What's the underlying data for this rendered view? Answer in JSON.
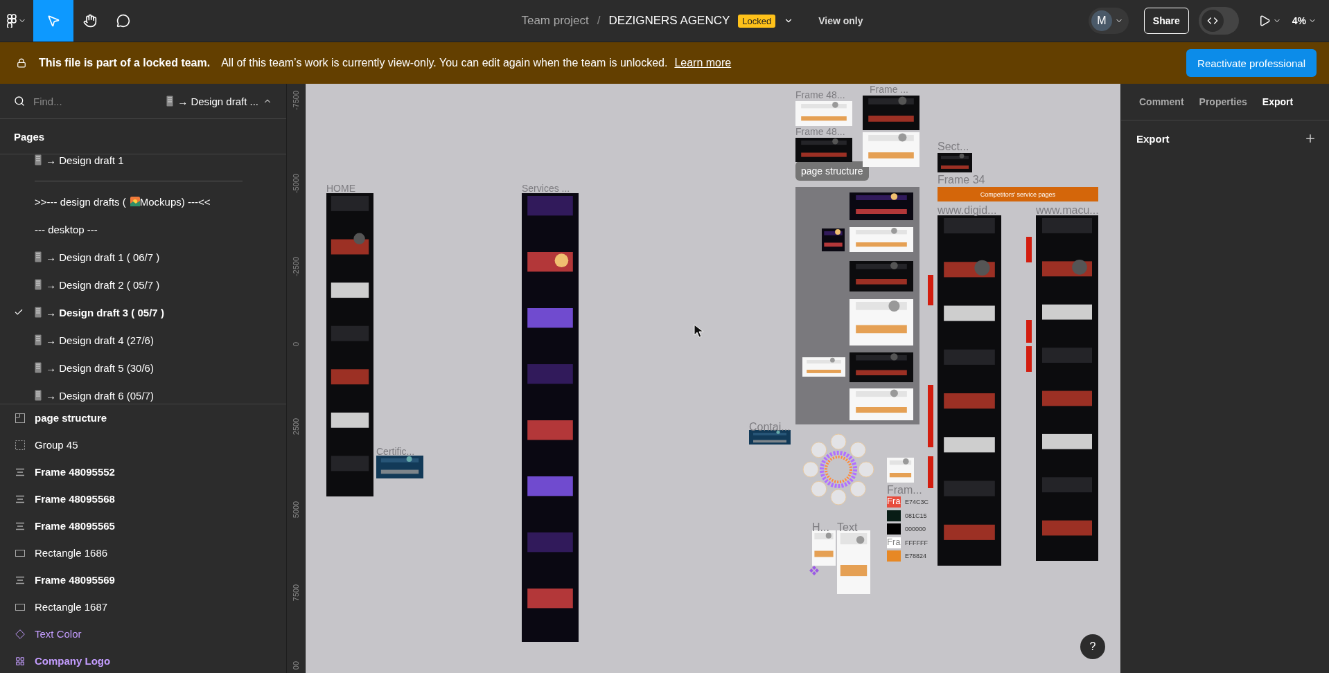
{
  "toolbar": {
    "tools": [
      {
        "kind": "logo",
        "selected": false
      },
      {
        "kind": "move",
        "selected": true
      },
      {
        "kind": "hand",
        "selected": false
      },
      {
        "kind": "comment",
        "selected": false
      }
    ],
    "breadcrumb": {
      "team": "Team project",
      "separator": "/",
      "file": "DEZIGNERS AGENCY",
      "badge": "Locked"
    },
    "view_mode": "View only",
    "avatar": "M",
    "dev_mode": {
      "on": false
    },
    "share": "Share",
    "zoom": "4%"
  },
  "banner": {
    "title": "This file is part of a locked team.",
    "message": "All of this team’s work is currently view-only. You can edit again when the team is unlocked.",
    "link": "Learn more",
    "button": "Reactivate professional"
  },
  "left_panel": {
    "search": {
      "placeholder": "Find..."
    },
    "page_selector": "→ Design draft ...",
    "pages_title": "Pages",
    "pages": [
      {
        "kind": "page",
        "text": "→ Design draft 1",
        "selected": false
      },
      {
        "kind": "divider"
      },
      {
        "kind": "heading",
        "text_before": ">>--- design drafts (",
        "text_after": "Mockups) ---<<"
      },
      {
        "kind": "heading",
        "text": "--- desktop ---"
      },
      {
        "kind": "page",
        "text": "→ Design draft 1 ( 06/7 )",
        "selected": false
      },
      {
        "kind": "page",
        "text": "→ Design draft 2 ( 05/7 )",
        "selected": false
      },
      {
        "kind": "page",
        "text": "→ Design draft 3 ( 05/7 )",
        "selected": true
      },
      {
        "kind": "page",
        "text": "→ Design draft 4 (27/6)",
        "selected": false
      },
      {
        "kind": "page",
        "text": "→ Design draft 5 (30/6)",
        "selected": false
      },
      {
        "kind": "page",
        "text": "→ Design draft 6 (05/7)",
        "selected": false
      }
    ],
    "layers": [
      {
        "kind": "section",
        "name": "page structure"
      },
      {
        "kind": "group",
        "name": "Group 45"
      },
      {
        "kind": "frame",
        "name": "Frame 48095552"
      },
      {
        "kind": "frame",
        "name": "Frame 48095568"
      },
      {
        "kind": "frame",
        "name": "Frame 48095565"
      },
      {
        "kind": "rectangle",
        "name": "Rectangle 1686"
      },
      {
        "kind": "frame",
        "name": "Frame 48095569"
      },
      {
        "kind": "rectangle",
        "name": "Rectangle 1687"
      },
      {
        "kind": "component",
        "name": "Text Color"
      },
      {
        "kind": "component_set",
        "name": "Company Logo"
      }
    ]
  },
  "canvas": {
    "ruler": [
      "-7500",
      "-5000",
      "-2500",
      "0",
      "2500",
      "5000",
      "7500",
      "00"
    ],
    "frames": [
      {
        "label": "HOME"
      },
      {
        "label": "Certific..."
      },
      {
        "label": "Services ..."
      },
      {
        "label": "Frame 48..."
      },
      {
        "label": "Frame 48..."
      },
      {
        "label": "Frame ..."
      },
      {
        "label": "Sect..."
      },
      {
        "label": "Frame 34"
      },
      {
        "label": "www.digid..."
      },
      {
        "label": "www.macu..."
      },
      {
        "label": "Contai..."
      },
      {
        "label": "Fram..."
      },
      {
        "label": "H..."
      },
      {
        "label": "Text"
      }
    ],
    "section_badge": "page structure",
    "help": "?",
    "note_bar": "Competitors' service pages",
    "swatches": [
      {
        "color": "#e74c3c",
        "label": "E74C3C",
        "name": "Fra"
      },
      {
        "color": "#081c15",
        "label": "081C15"
      },
      {
        "color": "#000000",
        "label": "000000"
      },
      {
        "color": "#ffffff",
        "label": "FFFFFF",
        "name": "Fra"
      },
      {
        "color": "#e78824",
        "label": "E78824"
      }
    ]
  },
  "right_panel": {
    "tabs": [
      {
        "label": "Comment",
        "selected": false
      },
      {
        "label": "Properties",
        "selected": false
      },
      {
        "label": "Export",
        "selected": true
      }
    ],
    "export_title": "Export"
  }
}
